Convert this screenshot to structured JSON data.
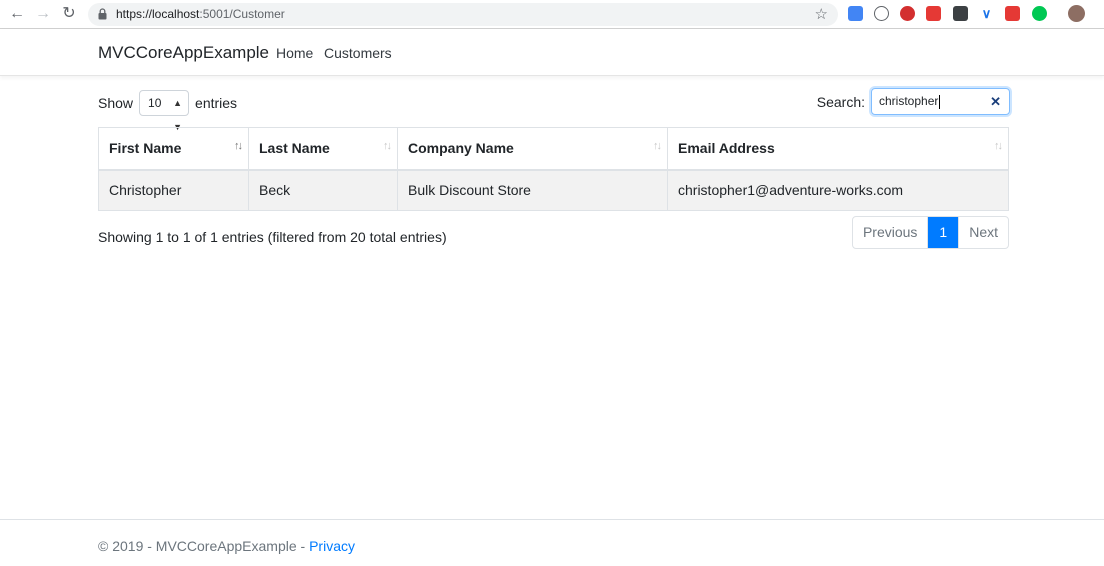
{
  "browser": {
    "url_host": "https://localhost",
    "url_rest": ":5001/Customer",
    "extension_colors": [
      "#4285f4",
      "#5f6368",
      "#d32f2f",
      "#e53935",
      "#3c4043",
      "#1a73e8",
      "#e53935",
      "#00c853"
    ]
  },
  "navbar": {
    "brand": "MVCCoreAppExample",
    "links": [
      "Home",
      "Customers"
    ]
  },
  "controls": {
    "show_label": "Show",
    "page_length": "10",
    "entries_label": "entries",
    "search_label": "Search:",
    "search_value": "christopher"
  },
  "table": {
    "columns": [
      "First Name",
      "Last Name",
      "Company Name",
      "Email Address"
    ],
    "rows": [
      [
        "Christopher",
        "Beck",
        "Bulk Discount Store",
        "christopher1@adventure-works.com"
      ]
    ]
  },
  "info": "Showing 1 to 1 of 1 entries (filtered from 20 total entries)",
  "pagination": {
    "previous": "Previous",
    "current": "1",
    "next": "Next"
  },
  "footer": {
    "copyright": "© 2019 - MVCCoreAppExample -",
    "privacy": "Privacy"
  },
  "colors": {
    "accent": "#007bff"
  }
}
